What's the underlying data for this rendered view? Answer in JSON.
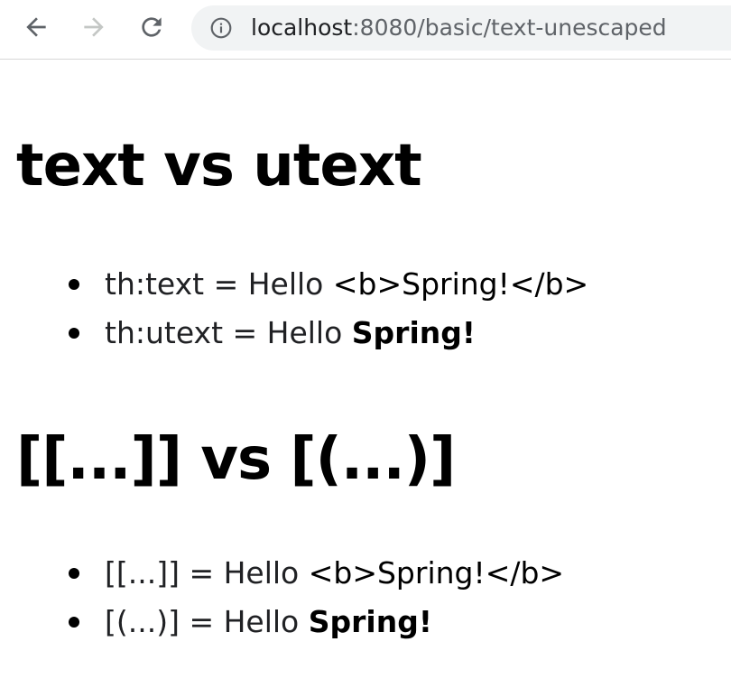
{
  "browser": {
    "url_host": "localhost",
    "url_port_path": ":8080/basic/text-unescaped"
  },
  "sections": [
    {
      "title": "text vs utext",
      "items": [
        {
          "prefix": "th:text = Hello ",
          "plain": "<b>Spring!</b>",
          "bold": ""
        },
        {
          "prefix": "th:utext = Hello ",
          "plain": "",
          "bold": "Spring!"
        }
      ]
    },
    {
      "title": "[[...]] vs [(...)]",
      "items": [
        {
          "prefix": "[[...]] = Hello ",
          "plain": "<b>Spring!</b>",
          "bold": ""
        },
        {
          "prefix": "[(...)] = Hello ",
          "plain": "",
          "bold": "Spring!"
        }
      ]
    }
  ]
}
